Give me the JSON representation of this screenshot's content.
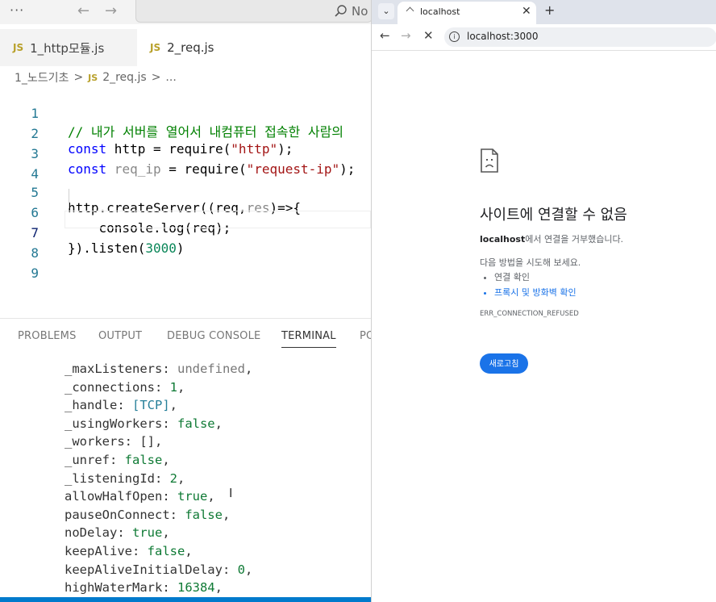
{
  "vscode": {
    "menu_dots": "···",
    "search_text": "No",
    "tabs": [
      {
        "label": "1_http모듈.js",
        "badge": "JS"
      },
      {
        "label": "2_req.js",
        "badge": "JS"
      }
    ],
    "breadcrumb": {
      "folder": "1_노드기초",
      "sep": ">",
      "badge": "JS",
      "file": "2_req.js",
      "more": "..."
    },
    "line_numbers": [
      "1",
      "2",
      "3",
      "4",
      "5",
      "6",
      "7",
      "8",
      "9"
    ],
    "code": {
      "l1_comment": "// 내가 서버를 열어서 내컴퓨터 접속한 사람의",
      "l2_kw": "const",
      "l2_rest": " http = require(",
      "l2_str": "\"http\"",
      "l2_end": ");",
      "l3_kw": "const",
      "l3_var": " req_ip",
      "l3_rest": " = require(",
      "l3_str": "\"request-ip\"",
      "l3_end": ");",
      "l5_a": "http.createServer((req,",
      "l5_b": "res",
      "l5_c": ")=>{",
      "l6": "    console.log(req);",
      "l7_a": "}).listen(",
      "l7_num": "3000",
      "l7_b": ")"
    },
    "panel_tabs": [
      "PROBLEMS",
      "OUTPUT",
      "DEBUG CONSOLE",
      "TERMINAL",
      "PO"
    ],
    "terminal": [
      {
        "key": "_maxListeners: ",
        "val": "undefined",
        "end": ",",
        "type": "u"
      },
      {
        "key": "_connections: ",
        "val": "1",
        "end": ",",
        "type": "g"
      },
      {
        "key": "_handle: ",
        "val": "[TCP]",
        "end": ",",
        "type": "t"
      },
      {
        "key": "_usingWorkers: ",
        "val": "false",
        "end": ",",
        "type": "g"
      },
      {
        "key": "_workers: ",
        "val": "[]",
        "end": ",",
        "type": "n"
      },
      {
        "key": "_unref: ",
        "val": "false",
        "end": ",",
        "type": "g"
      },
      {
        "key": "_listeningId: ",
        "val": "2",
        "end": ",",
        "type": "g"
      },
      {
        "key": "allowHalfOpen: ",
        "val": "true",
        "end": ",",
        "type": "g"
      },
      {
        "key": "pauseOnConnect: ",
        "val": "false",
        "end": ",",
        "type": "g"
      },
      {
        "key": "noDelay: ",
        "val": "true",
        "end": ",",
        "type": "g"
      },
      {
        "key": "keepAlive: ",
        "val": "false",
        "end": ",",
        "type": "g"
      },
      {
        "key": "keepAliveInitialDelay: ",
        "val": "0",
        "end": ",",
        "type": "g"
      },
      {
        "key": "highWaterMark: ",
        "val": "16384",
        "end": ",",
        "type": "g"
      }
    ]
  },
  "browser": {
    "dropdown_icon": "⌄",
    "tab_title": "localhost",
    "new_tab": "+",
    "url": "localhost:3000",
    "error": {
      "title": "사이트에 연결할 수 없음",
      "host": "localhost",
      "desc_rest": "에서 연결을 거부했습니다.",
      "try": "다음 방법을 시도해 보세요.",
      "suggestions": [
        "연결 확인",
        "프록시 및 방화벽 확인"
      ],
      "code": "ERR_CONNECTION_REFUSED",
      "reload": "새로고침"
    }
  },
  "colors": {
    "accent": "#1a73e8",
    "statusbar": "#007acc",
    "comment": "#008000",
    "keyword": "#0000ff",
    "string": "#a31515"
  }
}
